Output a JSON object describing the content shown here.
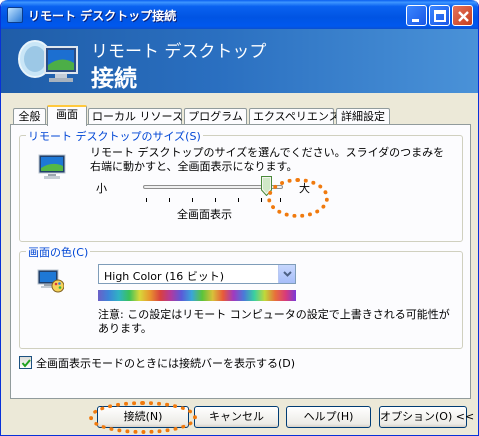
{
  "window": {
    "title": "リモート デスクトップ接続"
  },
  "banner": {
    "subtitle": "リモート デスクトップ",
    "title": "接続"
  },
  "tabs": [
    {
      "label": "全般",
      "active": false
    },
    {
      "label": "画面",
      "active": true
    },
    {
      "label": "ローカル リソース",
      "active": false
    },
    {
      "label": "プログラム",
      "active": false
    },
    {
      "label": "エクスペリエンス",
      "active": false
    },
    {
      "label": "詳細設定",
      "active": false
    }
  ],
  "size_group": {
    "legend": "リモート デスクトップのサイズ(S)",
    "description": "リモート デスクトップのサイズを選んでください。スライダのつまみを右端に動かすと、全画面表示になります。",
    "min_label": "小",
    "max_label": "大",
    "slider_value": "全画面表示",
    "slider_position": 1.0
  },
  "color_group": {
    "legend": "画面の色(C)",
    "selected": "High Color (16 ビット)",
    "note": "注意: この設定はリモート コンピュータの設定で上書きされる可能性があります。"
  },
  "checkbox": {
    "label": "全画面表示モードのときには接続バーを表示する(D)",
    "checked": true
  },
  "buttons": {
    "connect": "接続(N)",
    "cancel": "キャンセル",
    "help": "ヘルプ(H)",
    "options": "オプション(O) <<"
  },
  "colors": {
    "highlight_oval": "#f07a0e",
    "legend_text": "#0046d5"
  }
}
